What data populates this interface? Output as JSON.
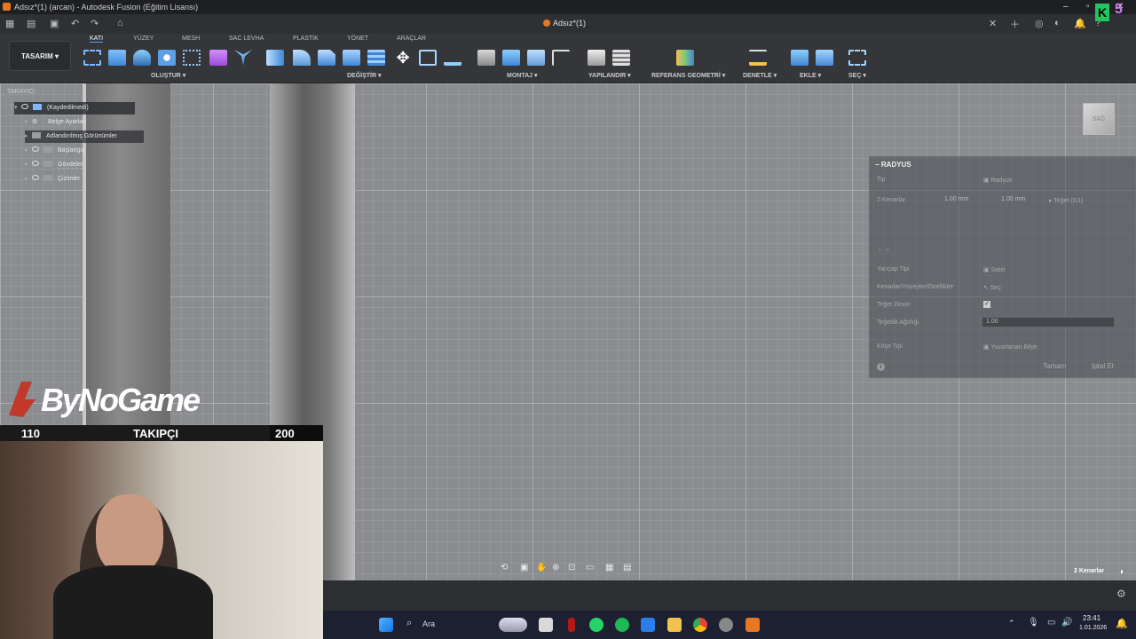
{
  "titlebar": {
    "title": "Adsız*(1) (arcan) - Autodesk Fusion (Eğitim Lisansı)"
  },
  "doc_tab": {
    "label": "Adsız*(1)"
  },
  "workspace": {
    "label": "TASARIM ▾"
  },
  "toolbar_tabs": [
    "KATI",
    "YÜZEY",
    "MESH",
    "SAC LEVHA",
    "PLASTİK",
    "YÖNET",
    "ARAÇLAR"
  ],
  "toolbar_groups": [
    "OLUŞTUR ▾",
    "DEĞİŞTİR ▾",
    "MONTAJ ▾",
    "YAPILANDIR ▾",
    "REFERANS GEOMETRİ ▾",
    "DENETLE ▾",
    "EKLE ▾",
    "SEÇ ▾"
  ],
  "browser": {
    "header": "TARAYICI",
    "root": "(Kaydedilmedi)",
    "items": [
      "Belge Ayarları",
      "Adlandırılmış Görünümler",
      "Başlangıç",
      "Gövdeler",
      "Çizimler"
    ]
  },
  "radius_panel": {
    "title": "RADYUS",
    "type_label": "Tip",
    "type_value": "Radyus",
    "edges_label": "2 Kenarlar",
    "val1": "1.00 mm",
    "val2": "1.00 mm",
    "tangent": "Teğet (G1)",
    "radius_type_label": "Yarıçap Tipi",
    "radius_type_value": "Sabit",
    "edges_faces_label": "Kenarlar/Yüzeyler/Özellikler",
    "select_label": "Seç",
    "tangent_chain_label": "Teğet Zinciri",
    "tangent_weight_label": "Teğetlik Ağırlığı",
    "tangent_weight_value": "1.00",
    "corner_type_label": "Köşe Tipi",
    "corner_type_value": "Yuvarlanan Bilye",
    "ok": "Tamam",
    "cancel": "İptal Et"
  },
  "overlay": {
    "logo": "ByNoGame",
    "left_count": "110",
    "follow_label": "TAKIPÇI",
    "right_count": "200"
  },
  "status": {
    "edges": "2 Kenarlar"
  },
  "taskbar": {
    "search": "Ara",
    "time": "23:41",
    "date": "1.01.2026"
  },
  "viewcube": {
    "label": "SAĞ"
  },
  "colors": {
    "accent": "#4ea3ff",
    "fusion_orange": "#e87722"
  }
}
